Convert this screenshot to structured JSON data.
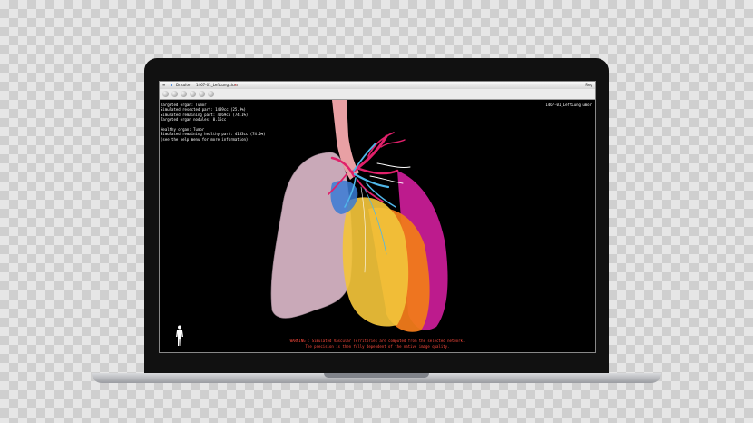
{
  "window": {
    "tab_text": "Dr.suite",
    "tab_file": "1467-01_LeftLung.dcm",
    "corner_label": "Reg",
    "case_id": "1467-01_LeftLungTumor"
  },
  "stats": {
    "lines": [
      "Targeted organ: Tumor",
      "Simulated resected part: 1489cc (25.9%)",
      "Simulated remaining part: 4269cc (74.1%)",
      "Targeted organ nodules: 0.15cc",
      "",
      "Healthy organ: Tumor",
      "Simulated remaining healthy part: 4183cc (74.0%)",
      "(see the help menu for more information)"
    ]
  },
  "warning": {
    "line1": "WARNING : Simulated Vascular Territories are computed from the selected network.",
    "line2": "The precision is then fully dependent of the native image quality."
  },
  "colors": {
    "accent_warning": "#ff4a3c",
    "lung_left": "#c9a9b8",
    "lobe_yellow": "#f2c33a",
    "lobe_orange": "#f07a1a",
    "lobe_magenta": "#d21e9c",
    "vessel_red": "#e0206a",
    "vessel_blue": "#4fb6e8",
    "trachea": "#e8a0a4"
  },
  "icons": {
    "toolbar": [
      "home-icon",
      "zoom-icon",
      "rotate-icon",
      "camera-icon",
      "layers-icon",
      "settings-icon"
    ],
    "orientation": "human-figure-icon"
  }
}
